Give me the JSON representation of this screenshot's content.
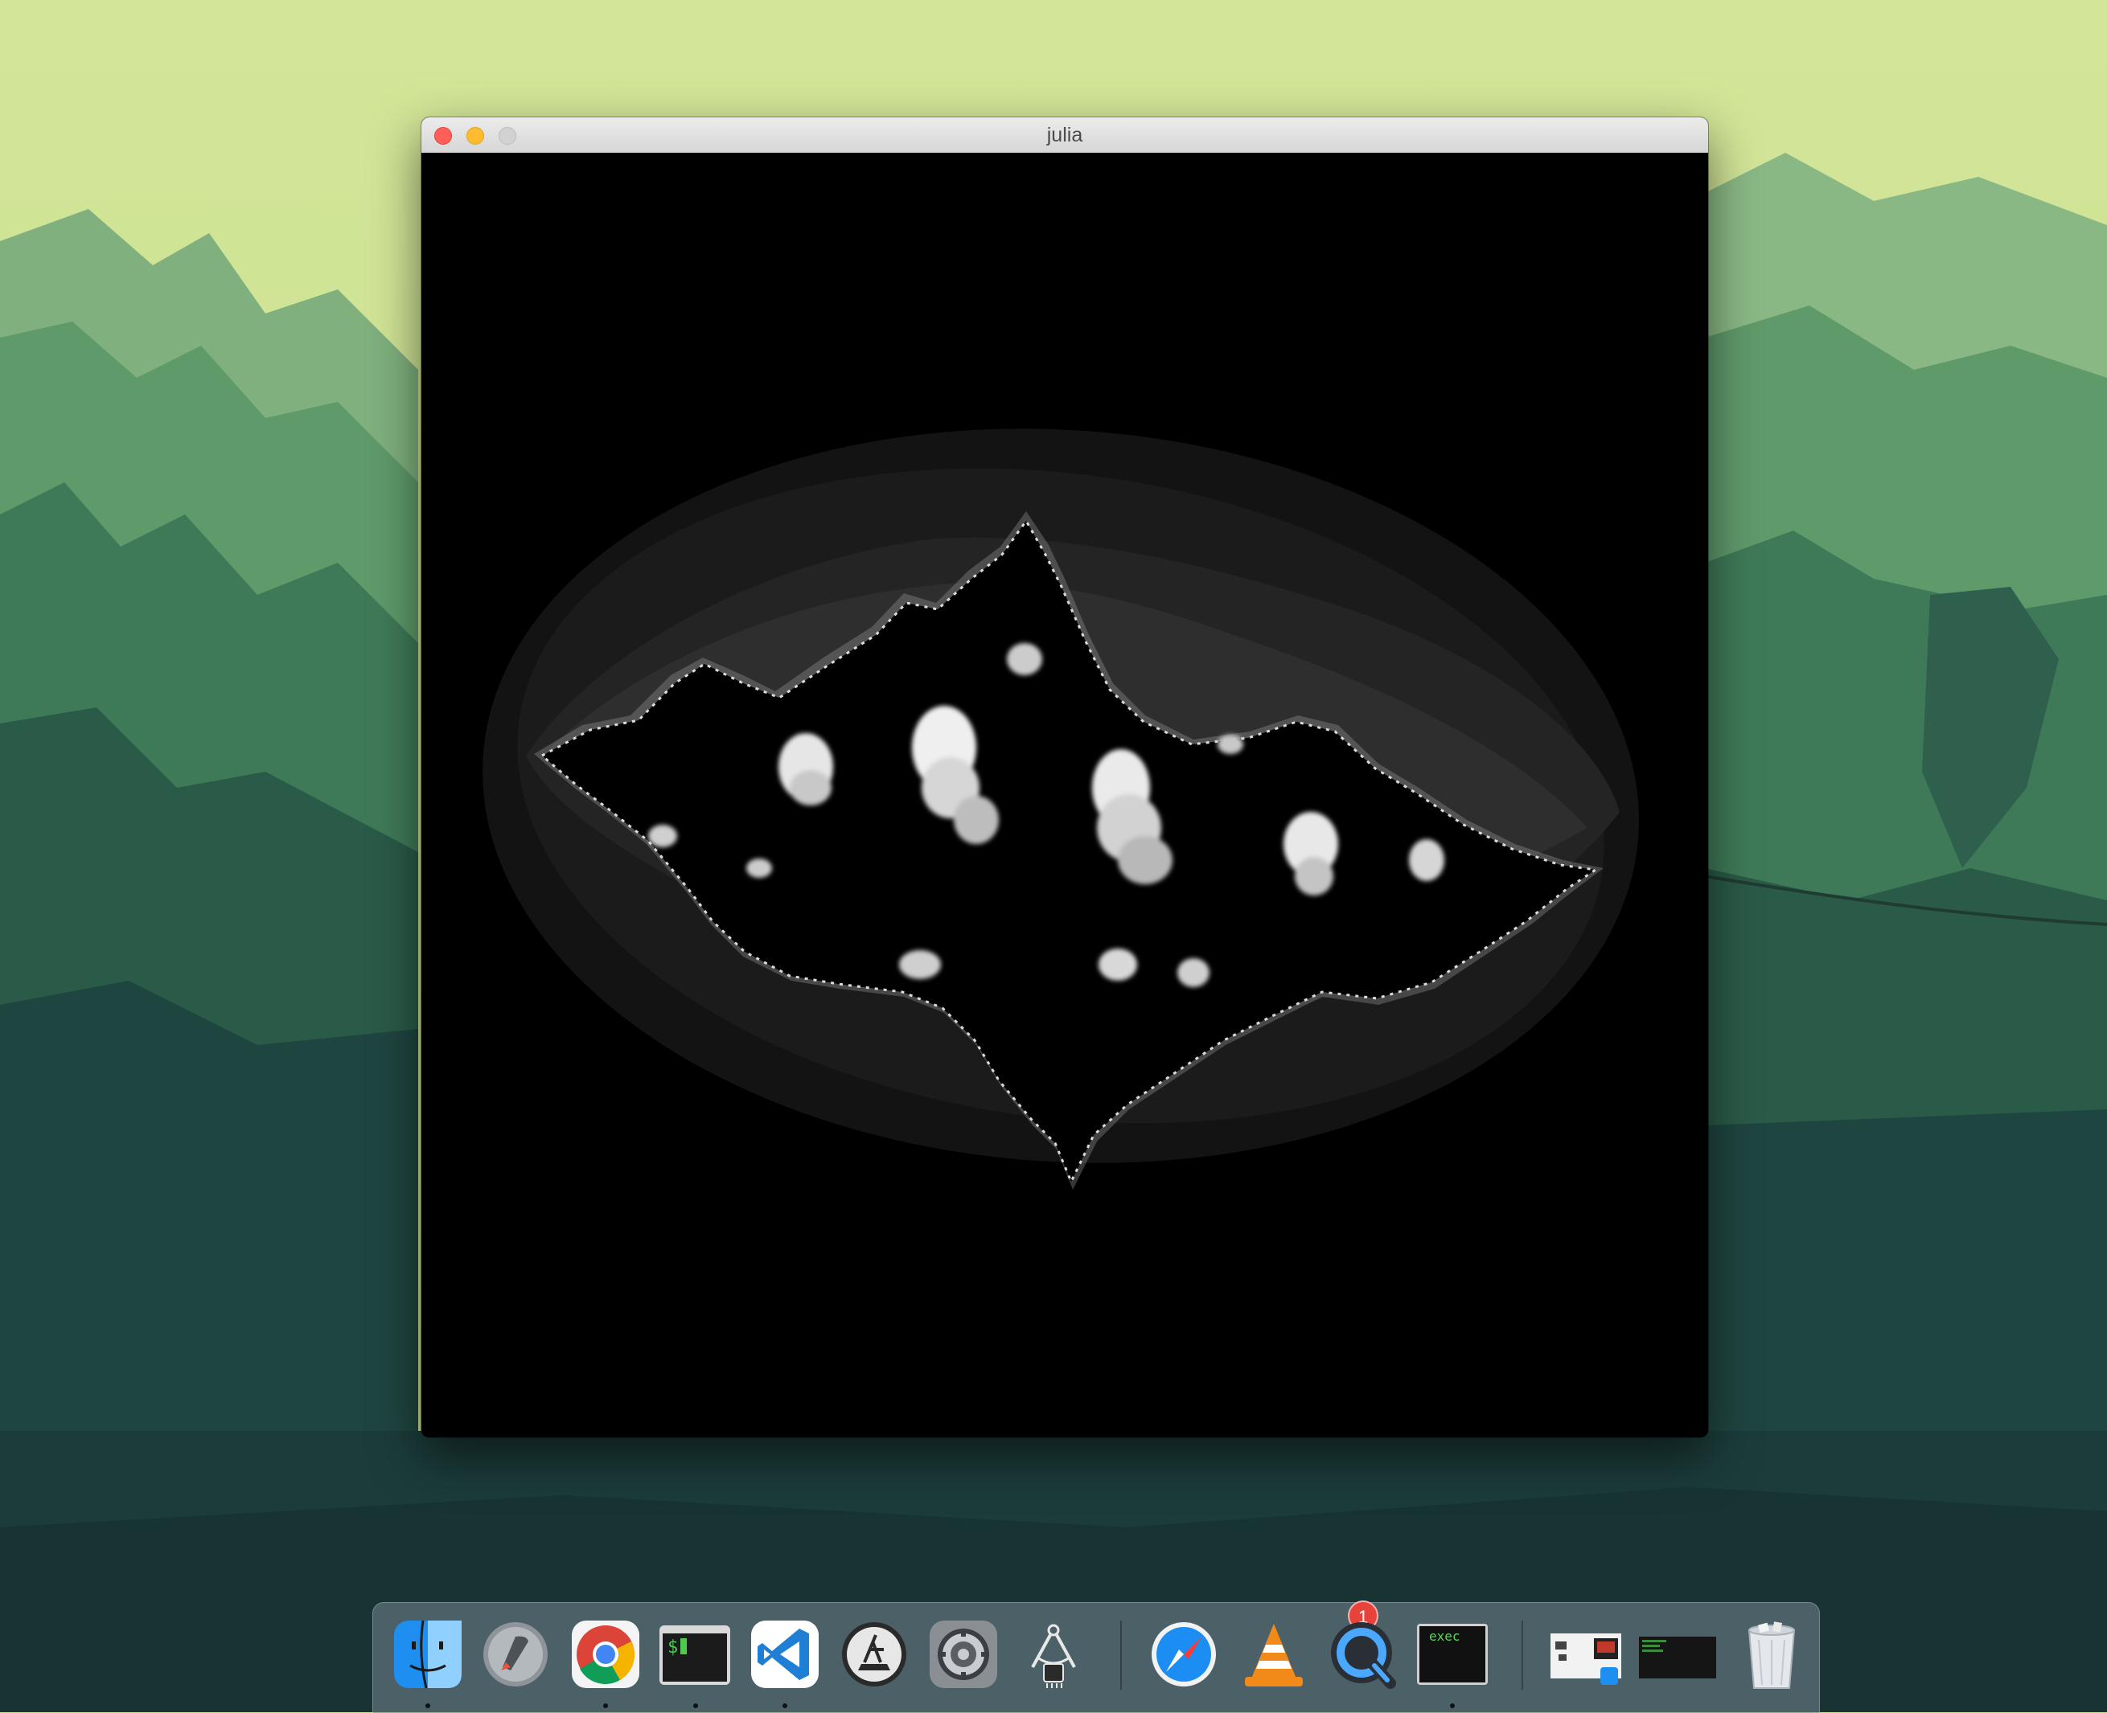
{
  "window": {
    "title": "julia"
  },
  "dock": {
    "items": [
      {
        "name": "finder-icon",
        "running": true
      },
      {
        "name": "launchpad-icon",
        "running": false
      },
      {
        "name": "chrome-icon",
        "running": true
      },
      {
        "name": "terminal-icon",
        "running": true
      },
      {
        "name": "vscode-icon",
        "running": true
      },
      {
        "name": "xcode-app-icon",
        "running": false
      },
      {
        "name": "system-preferences-icon",
        "running": false,
        "badge": "1"
      },
      {
        "name": "compass-tool-icon",
        "running": false
      },
      {
        "name": "safari-icon",
        "running": false
      },
      {
        "name": "vlc-icon",
        "running": false
      },
      {
        "name": "quicktime-icon",
        "running": false
      },
      {
        "name": "exec-terminal-icon",
        "running": true,
        "label": "exec"
      },
      {
        "name": "downloads-stack-icon",
        "running": false
      },
      {
        "name": "minimized-window-icon",
        "running": false
      },
      {
        "name": "trash-icon",
        "running": false
      }
    ],
    "badge_text": "1",
    "exec_label": "exec"
  },
  "colors": {
    "wallpaper_sky": "#cfe394",
    "fractal_background": "#000000",
    "close": "#fe5f57",
    "minimize": "#febc2e",
    "zoom": "#d2d2d2"
  }
}
